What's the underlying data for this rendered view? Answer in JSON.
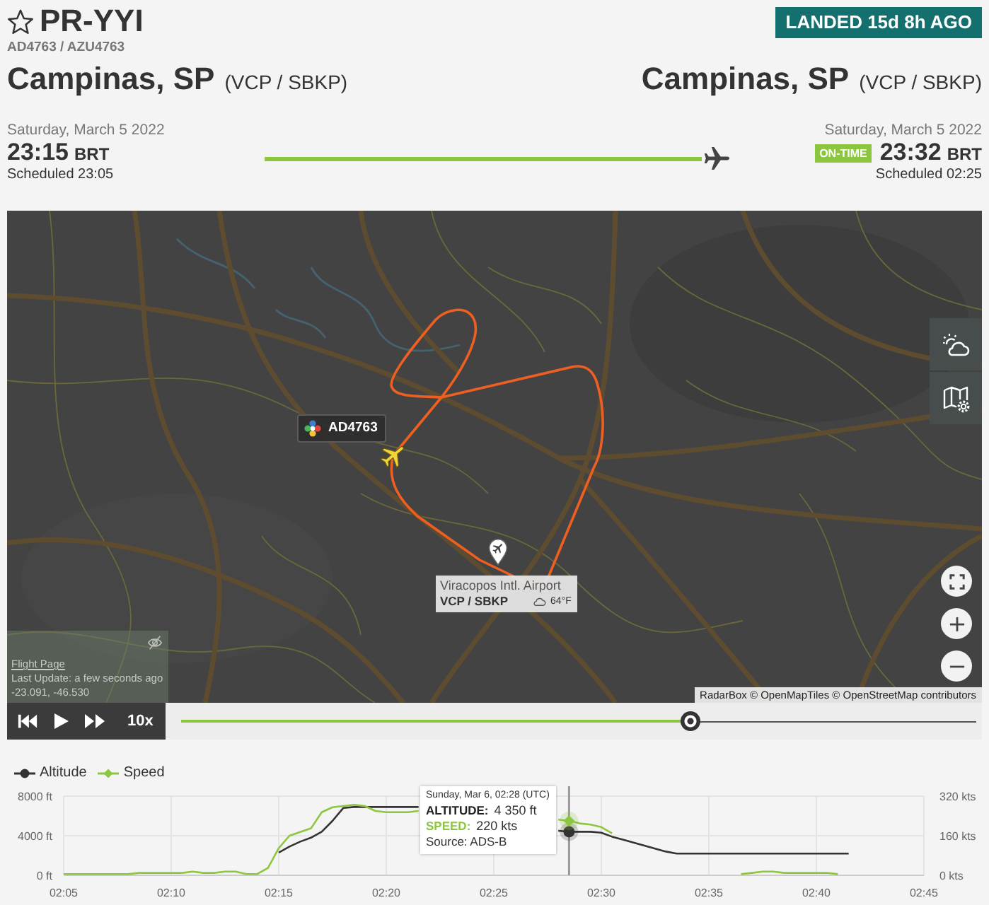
{
  "flight": {
    "favorite": false,
    "registration": "PR-YYI",
    "codes": "AD4763 / AZU4763",
    "status": "LANDED 15d 8h AGO"
  },
  "origin": {
    "city": "Campinas, SP",
    "airport_codes": "(VCP / SBKP)",
    "date": "Saturday, March 5 2022",
    "time": "23:15",
    "timezone": "BRT",
    "scheduled": "Scheduled 23:05"
  },
  "destination": {
    "city": "Campinas, SP",
    "airport_codes": "(VCP / SBKP)",
    "date": "Saturday, March 5 2022",
    "badge": "ON-TIME",
    "time": "23:32",
    "timezone": "BRT",
    "scheduled": "Scheduled 02:25"
  },
  "progress": {
    "level": 1
  },
  "map": {
    "aircraft_label": "AD4763",
    "airport": {
      "name": "Viracopos Intl. Airport",
      "codes": "VCP / SBKP",
      "temperature": "64°F"
    },
    "info_panel": {
      "link": "Flight Page",
      "last_update": "Last Update: a few seconds ago",
      "coordinates": "-23.091, -46.530"
    },
    "attribution": "RadarBox © OpenMapTiles © OpenStreetMap contributors"
  },
  "playback": {
    "speed": "10x",
    "level": 0.64
  },
  "chart": {
    "chart_data": {
      "type": "line",
      "grid": true,
      "categories": [
        "02:05",
        null,
        null,
        null,
        null,
        null,
        null,
        null,
        null,
        null,
        "02:10",
        null,
        null,
        null,
        null,
        null,
        null,
        null,
        null,
        null,
        "02:15",
        null,
        null,
        null,
        null,
        null,
        null,
        null,
        null,
        null,
        "02:20",
        null,
        null,
        null,
        null,
        null,
        null,
        null,
        null,
        null,
        "02:25",
        null,
        null,
        null,
        null,
        null,
        null,
        null,
        null,
        null,
        "02:30",
        null,
        null,
        null,
        null,
        null,
        null,
        null,
        null,
        null,
        "02:35",
        null,
        null,
        null,
        null,
        null,
        null,
        null,
        null,
        null,
        "02:40",
        null,
        null,
        null,
        null,
        null,
        null,
        null,
        null,
        null,
        "02:45"
      ],
      "ylim": [
        0,
        8000
      ],
      "yticks": [
        {
          "value": 0,
          "label": "0 ft"
        },
        {
          "value": 4000,
          "label": "4000 ft"
        },
        {
          "value": 8000,
          "label": "8000 ft"
        }
      ],
      "y2lim": [
        0,
        320
      ],
      "y2ticks": [
        {
          "value": 0,
          "label": "0 kts"
        },
        {
          "value": 160,
          "label": "160 kts"
        },
        {
          "value": 320,
          "label": "320 kts"
        }
      ],
      "series": [
        {
          "name": "Altitude",
          "color": "#333333",
          "values": [
            null,
            null,
            null,
            null,
            null,
            null,
            null,
            null,
            null,
            null,
            null,
            null,
            null,
            null,
            null,
            null,
            null,
            null,
            null,
            null,
            2300,
            2900,
            3400,
            3800,
            4400,
            5500,
            6800,
            6900,
            6900,
            6900,
            6900,
            6900,
            6900,
            6900,
            null,
            null,
            null,
            null,
            null,
            null,
            null,
            null,
            null,
            null,
            null,
            null,
            4500,
            4400,
            4400,
            4400,
            4300,
            3900,
            3600,
            3300,
            3000,
            2700,
            2400,
            2200,
            2200,
            2200,
            2200,
            2200,
            2200,
            2200,
            2200,
            2200,
            2200,
            2200,
            2200,
            2200,
            2200,
            2200,
            2200,
            2200,
            null,
            null,
            null,
            null,
            null,
            null,
            null
          ]
        },
        {
          "name": "Speed",
          "color": "#8dc63f",
          "axis": "y2",
          "values": [
            5,
            5,
            5,
            5,
            5,
            5,
            5,
            10,
            10,
            10,
            10,
            10,
            15,
            10,
            10,
            15,
            15,
            5,
            5,
            30,
            110,
            160,
            175,
            190,
            255,
            275,
            280,
            285,
            280,
            260,
            255,
            255,
            255,
            260,
            null,
            null,
            null,
            null,
            null,
            null,
            null,
            null,
            null,
            null,
            null,
            null,
            225,
            220,
            210,
            205,
            195,
            170,
            null,
            null,
            null,
            null,
            null,
            null,
            null,
            null,
            null,
            null,
            null,
            5,
            10,
            15,
            15,
            10,
            10,
            10,
            10,
            10,
            5,
            null,
            null,
            null,
            null,
            null,
            null,
            null,
            null
          ]
        }
      ]
    },
    "tooltip": {
      "title": "Sunday, Mar 6, 02:28 (UTC)",
      "rows": [
        {
          "label": "ALTITUDE:",
          "value": "4 350 ft",
          "color": "#222222"
        },
        {
          "label": "SPEED:",
          "value": "220 kts",
          "color": "#8dc63f"
        }
      ],
      "source": "Source: ADS-B"
    }
  }
}
